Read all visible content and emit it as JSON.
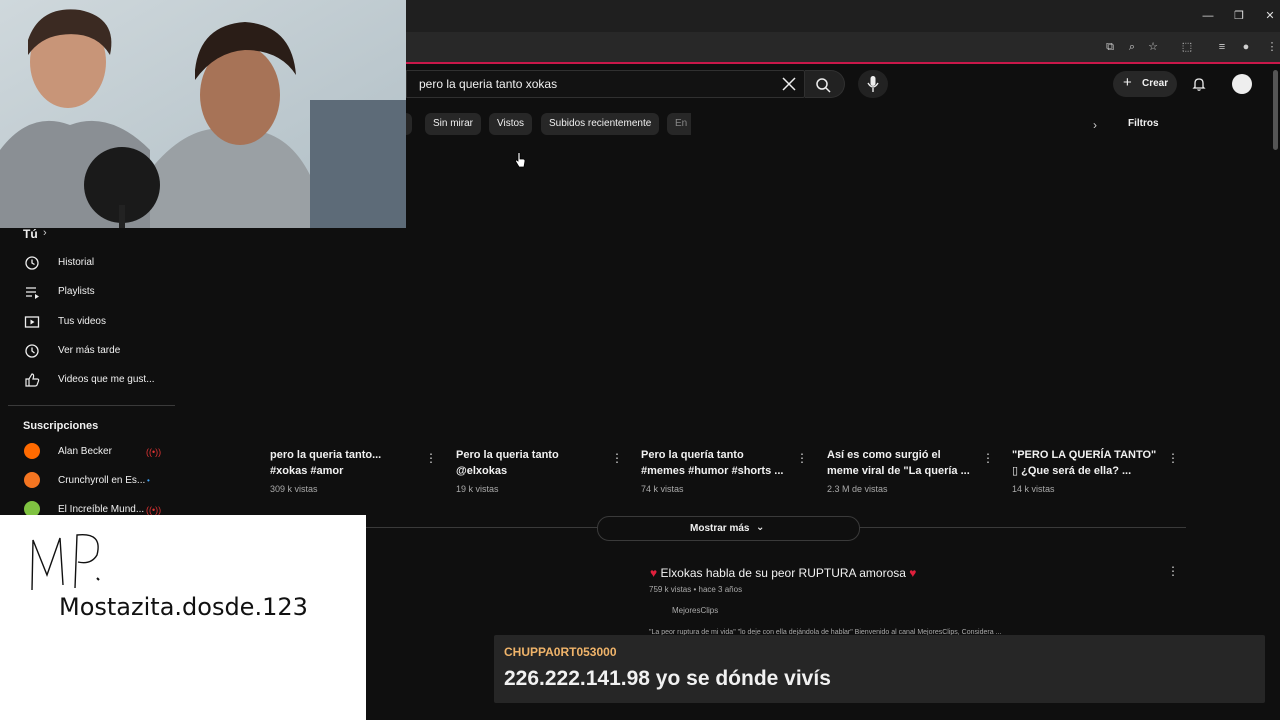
{
  "search": {
    "query": "pero la queria tanto xokas"
  },
  "header": {
    "create_label": "Crear"
  },
  "chips": {
    "items": [
      {
        "label": "s"
      },
      {
        "label": "Sin mirar"
      },
      {
        "label": "Vistos"
      },
      {
        "label": "Subidos recientemente"
      },
      {
        "label": "En"
      }
    ],
    "filters_label": "Filtros"
  },
  "sidebar": {
    "you_label": "Tú",
    "items": [
      {
        "label": "Historial",
        "icon": "history-icon"
      },
      {
        "label": "Playlists",
        "icon": "playlists-icon"
      },
      {
        "label": "Tus videos",
        "icon": "your-videos-icon"
      },
      {
        "label": "Ver más tarde",
        "icon": "watch-later-icon"
      },
      {
        "label": "Videos que me gust...",
        "icon": "liked-videos-icon"
      }
    ],
    "subscriptions_label": "Suscripciones",
    "subscriptions": [
      {
        "label": "Alan Becker",
        "color": "#ff6a00"
      },
      {
        "label": "Crunchyroll en Es...",
        "color": "#f47521"
      },
      {
        "label": "El Increíble Mund...",
        "color": "#7fc241"
      }
    ]
  },
  "shorts": [
    {
      "title": "pero la queria tanto...\n#xokas #amor",
      "views": "309 k vistas"
    },
    {
      "title": "Pero la queria tanto\n@elxokas",
      "views": "19 k vistas"
    },
    {
      "title": "Pero la quería tanto\n#memes #humor #shorts ...",
      "views": "74 k vistas"
    },
    {
      "title": "Así es como surgió el\nmeme viral de \"La quería ...",
      "views": "2.3 M de vistas"
    },
    {
      "title": "\"PERO LA QUERÍA TANTO\"\n▯ ¿Que será de ella? ...",
      "views": "14 k vistas"
    }
  ],
  "show_more_label": "Mostrar más",
  "result": {
    "title": "Elxokas habla de su peor RUPTURA amorosa",
    "meta": "759 k vistas • hace 3 años",
    "channel": "MejoresClips",
    "description": "\"La peor ruptura de mi vida\" \"lo deje con ella dejándola de hablar\" Bienvenido al canal MejoresClips, Considera ..."
  },
  "chat": {
    "username": "CHUPPA0RT053000",
    "message": "226.222.141.98 yo se dónde vivís"
  },
  "whiteboard": {
    "text": "Mostazita.dosde.123"
  },
  "colors": {
    "accent": "#c9184a",
    "chat_user": "#f0b46a",
    "heart": "#e0203c"
  }
}
